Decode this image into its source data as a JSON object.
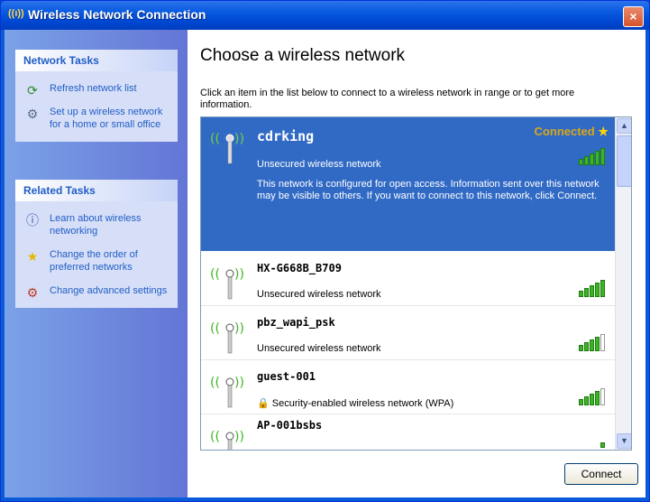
{
  "window": {
    "title": "Wireless Network Connection",
    "close_glyph": "×"
  },
  "sidebar": {
    "network_tasks": {
      "heading": "Network Tasks",
      "items": [
        {
          "label": "Refresh network list",
          "icon": "refresh-icon"
        },
        {
          "label": "Set up a wireless network for a home or small office",
          "icon": "setup-network-icon"
        }
      ]
    },
    "related_tasks": {
      "heading": "Related Tasks",
      "items": [
        {
          "label": "Learn about wireless networking",
          "icon": "info-icon"
        },
        {
          "label": "Change the order of preferred networks",
          "icon": "star-icon"
        },
        {
          "label": "Change advanced settings",
          "icon": "settings-icon"
        }
      ]
    }
  },
  "main": {
    "heading": "Choose a wireless network",
    "description": "Click an item in the list below to connect to a wireless network in range or to get more information.",
    "connect_label": "Connect"
  },
  "networks": [
    {
      "name": "cdrking",
      "security": "Unsecured wireless network",
      "status": "Connected",
      "selected": true,
      "info": "This network is configured for open access. Information sent over this network may be visible to others. If you want to connect to this network, click Connect.",
      "signal_bars": 5
    },
    {
      "name": "HX-G668B_B709",
      "security": "Unsecured wireless network",
      "signal_bars": 5
    },
    {
      "name": "pbz_wapi_psk",
      "security": "Unsecured wireless network",
      "signal_bars": 4
    },
    {
      "name": "guest-001",
      "security": "Security-enabled wireless network (WPA)",
      "signal_bars": 4
    },
    {
      "name": "AP-001bsbs",
      "security": "",
      "signal_bars": 1
    }
  ],
  "colors": {
    "selection": "#316ac5",
    "task_link": "#215dc6",
    "signal": "#3cb522",
    "connected": "#d8a818"
  }
}
